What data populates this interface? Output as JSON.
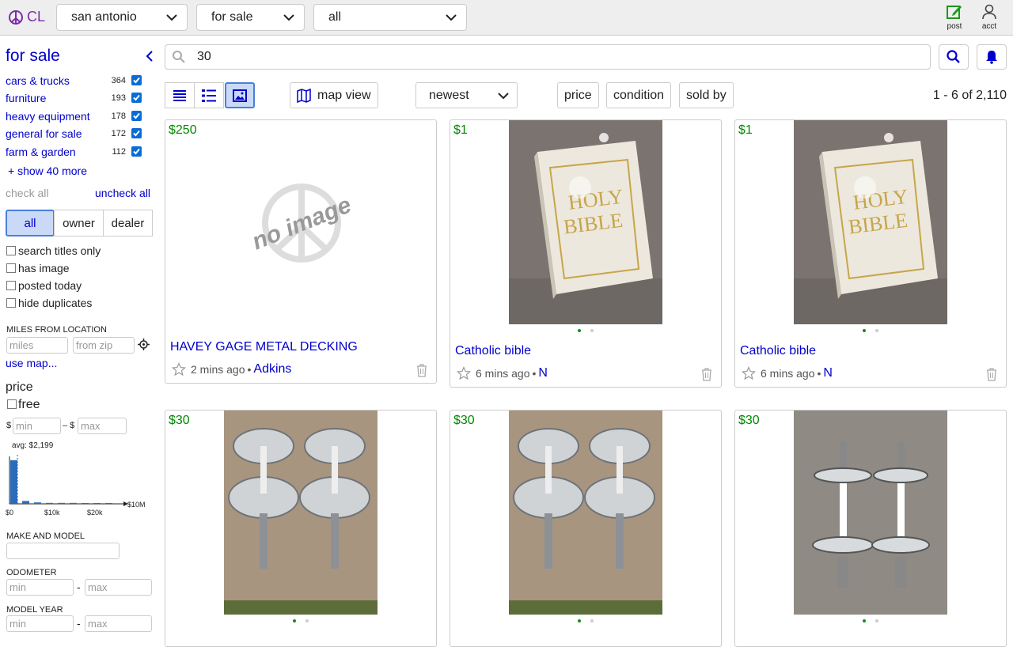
{
  "header": {
    "logo": "CL",
    "location": "san antonio",
    "category": "for sale",
    "subcategory": "all",
    "post_label": "post",
    "acct_label": "acct"
  },
  "sidebar": {
    "title": "for sale",
    "categories": [
      {
        "name": "cars & trucks",
        "count": "364"
      },
      {
        "name": "furniture",
        "count": "193"
      },
      {
        "name": "heavy equipment",
        "count": "178"
      },
      {
        "name": "general for sale",
        "count": "172"
      },
      {
        "name": "farm & garden",
        "count": "112"
      }
    ],
    "show_more": "+ show 40 more",
    "check_all": "check all",
    "uncheck_all": "uncheck all",
    "seller_tabs": [
      "all",
      "owner",
      "dealer"
    ],
    "options": [
      "search titles only",
      "has image",
      "posted today",
      "hide duplicates"
    ],
    "miles_label": "MILES FROM LOCATION",
    "miles_placeholder": "miles",
    "zip_placeholder": "from zip",
    "use_map": "use map...",
    "price_label": "price",
    "free_label": "free",
    "dollar": "$",
    "range_dash": "– $",
    "min_placeholder": "min",
    "max_placeholder": "max",
    "avg_label": "avg: $2,199",
    "hist_ticks": [
      "$0",
      "$10k",
      "$20k",
      "$10M"
    ],
    "make_model_label": "MAKE AND MODEL",
    "odometer_label": "ODOMETER",
    "model_year_label": "MODEL YEAR",
    "hyphen": "-"
  },
  "histogram": {
    "bars": [
      0.92,
      0.06,
      0.03,
      0.02,
      0.02,
      0.02,
      0.01,
      0.01,
      0.01
    ]
  },
  "search": {
    "query": "30"
  },
  "toolbar": {
    "map_view": "map view",
    "sort": "newest",
    "filters": [
      "price",
      "condition",
      "sold by"
    ],
    "range": "1 - 6 of 2,110"
  },
  "listings": [
    {
      "price": "$250",
      "title": "HAVEY GAGE METAL DECKING",
      "time": "2 mins ago",
      "by": "Adkins",
      "image": "none"
    },
    {
      "price": "$1",
      "title": "Catholic bible",
      "time": "6 mins ago",
      "by": "N",
      "image": "bible"
    },
    {
      "price": "$1",
      "title": "Catholic bible",
      "time": "6 mins ago",
      "by": "N",
      "image": "bible"
    },
    {
      "price": "$30",
      "title": "",
      "time": "",
      "by": "",
      "image": "dumbbells"
    },
    {
      "price": "$30",
      "title": "",
      "time": "",
      "by": "",
      "image": "dumbbells"
    },
    {
      "price": "$30",
      "title": "",
      "time": "",
      "by": "",
      "image": "dumbbells-long"
    }
  ],
  "no_image_text": "no image",
  "bullet": "•",
  "colors": {
    "link": "#0000cc",
    "price": "#008800",
    "accent": "#7a2da6",
    "active": "#c9d9f7"
  }
}
